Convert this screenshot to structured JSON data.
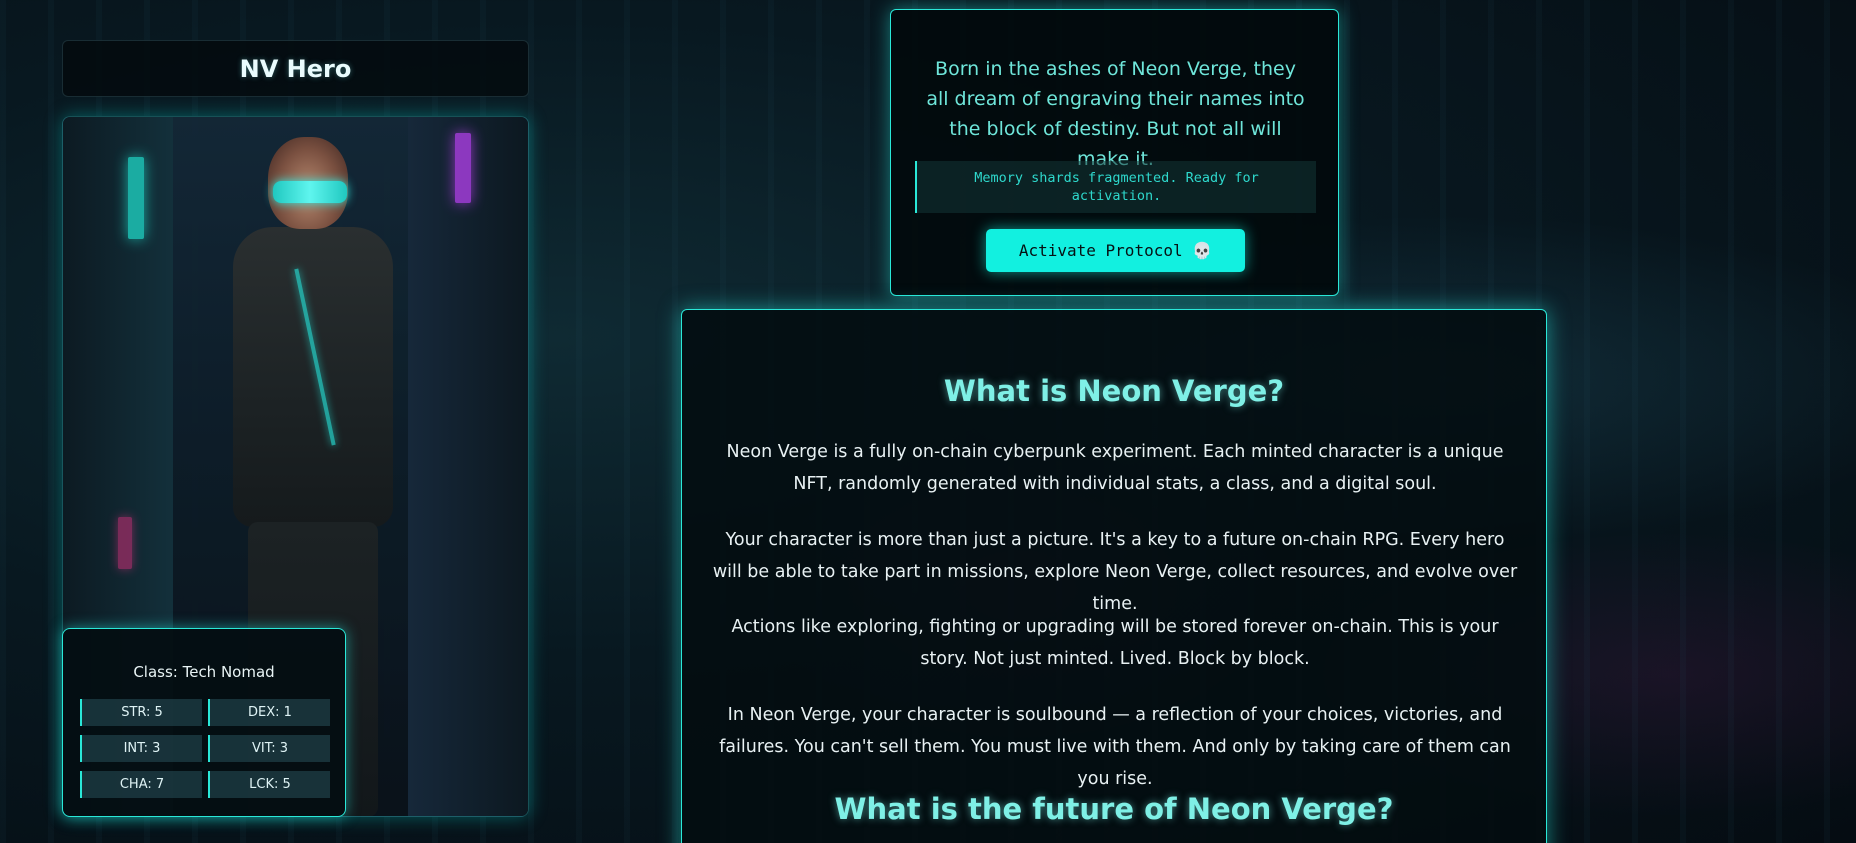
{
  "hero": {
    "title": "NV Hero",
    "class_label": "Class: Tech Nomad",
    "stats": [
      {
        "label": "STR: 5"
      },
      {
        "label": "DEX: 1"
      },
      {
        "label": "INT: 3"
      },
      {
        "label": "VIT: 3"
      },
      {
        "label": "CHA: 7"
      },
      {
        "label": "LCK: 5"
      }
    ]
  },
  "lore": {
    "text": "Born in the ashes of Neon Verge, they all dream of engraving their names into the block of destiny. But not all will make it.",
    "memory_status": "Memory shards fragmented. Ready for activation.",
    "activate_button": "Activate Protocol 💀"
  },
  "info": {
    "heading_1": "What is Neon Verge?",
    "paragraphs": [
      "Neon Verge is a fully on-chain cyberpunk experiment. Each minted character is a unique NFT, randomly generated with individual stats, a class, and a digital soul.",
      "Your character is more than just a picture. It's a key to a future on-chain RPG. Every hero will be able to take part in missions, explore Neon Verge, collect resources, and evolve over time.",
      "Actions like exploring, fighting or upgrading will be stored forever on-chain. This is your story. Not just minted. Lived. Block by block.",
      "In Neon Verge, your character is soulbound — a reflection of your choices, victories, and failures. You can't sell them. You must live with them. And only by taking care of them can you rise."
    ],
    "heading_2": "What is the future of Neon Verge?"
  },
  "colors": {
    "accent": "#2ae8d8",
    "button": "#12f0e0",
    "heading": "#7ff0e6",
    "lore_text": "#6fe6da"
  }
}
